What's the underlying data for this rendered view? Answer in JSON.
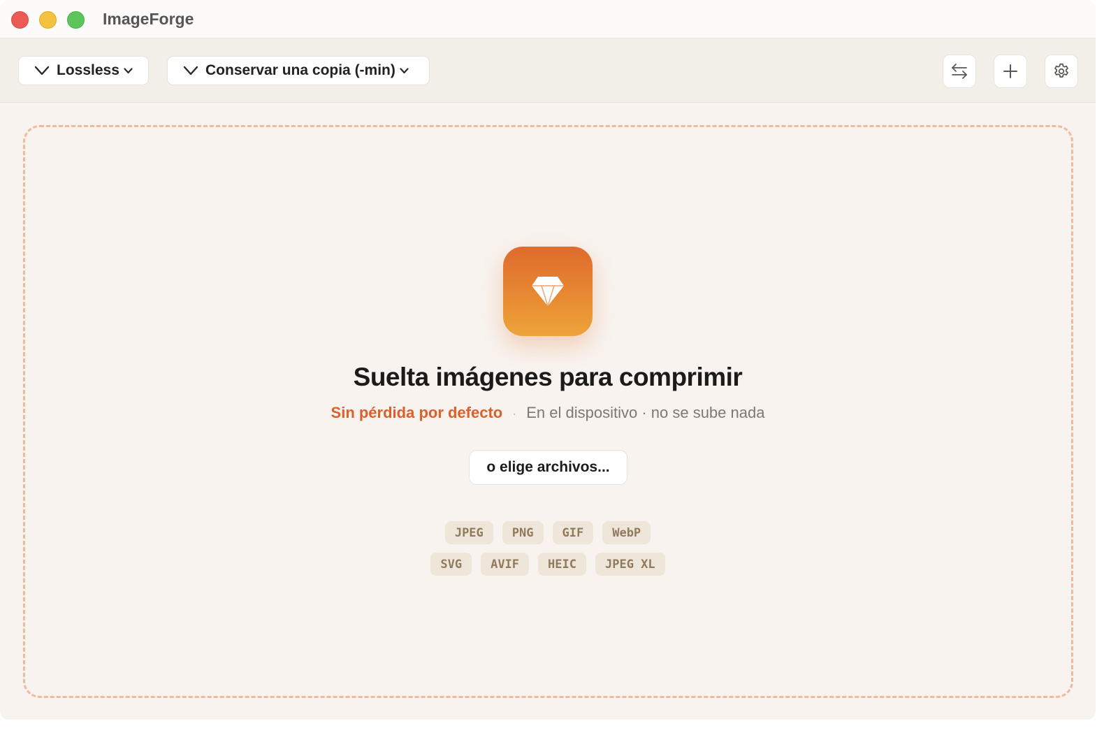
{
  "window": {
    "title": "ImageForge",
    "controls": [
      "close",
      "minimize",
      "maximize"
    ]
  },
  "toolbar": {
    "quality_dropdown": {
      "label": "Lossless",
      "icon": "chevron-down-icon"
    },
    "output_dropdown": {
      "label": "Conservar una copia (-min)",
      "icon": "chevron-down-icon"
    },
    "buttons": [
      {
        "name": "swap",
        "icon": "swap-arrows-icon"
      },
      {
        "name": "add",
        "icon": "plus-icon"
      },
      {
        "name": "settings",
        "icon": "gear-icon"
      }
    ]
  },
  "dropzone": {
    "icon": "diamond-icon",
    "headline": "Suelta imágenes para comprimir",
    "accent_text": "Sin pérdida por defecto",
    "separator": "·",
    "info_text": "En el dispositivo · no se sube nada",
    "choose_label": "o elige archivos...",
    "formats_row1": [
      "JPEG",
      "PNG",
      "GIF",
      "WebP"
    ],
    "formats_row2": [
      "SVG",
      "AVIF",
      "HEIC",
      "JPEG XL"
    ]
  },
  "colors": {
    "accent": "#dd5f2a",
    "icon_gradient_top": "#df6a2d",
    "icon_gradient_bottom": "#eda43a",
    "dropzone_border": "#f0b9a0",
    "format_chip_bg": "#efe6da",
    "format_chip_text": "#8f7a5d"
  }
}
